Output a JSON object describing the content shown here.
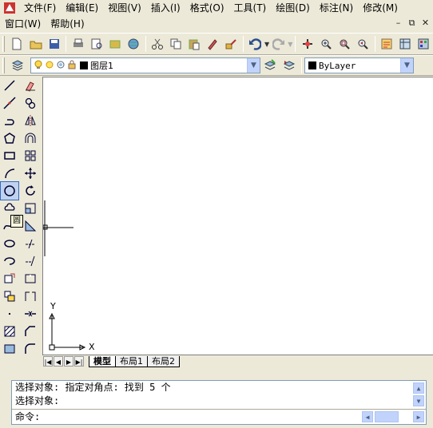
{
  "menus_row1": [
    "文件(F)",
    "编辑(E)",
    "视图(V)",
    "插入(I)",
    "格式(O)",
    "工具(T)",
    "绘图(D)",
    "标注(N)",
    "修改(M)"
  ],
  "menus_row2": [
    "窗口(W)",
    "帮助(H)"
  ],
  "window_controls": [
    "–",
    "⧉",
    "✕"
  ],
  "layer": {
    "name": "图层1"
  },
  "linetype": {
    "value": "ByLayer"
  },
  "tooltip": "圆",
  "ucs": {
    "x_label": "X",
    "y_label": "Y"
  },
  "tabs": [
    "模型",
    "布局1",
    "布局2"
  ],
  "command": {
    "line1": "选择对象: 指定对角点: 找到 5 个",
    "line2": "选择对象:",
    "prompt": "命令:"
  },
  "colors": {
    "canvas": "#ffffff",
    "chrome": "#ece9d8",
    "highlight": "#316ac5"
  }
}
